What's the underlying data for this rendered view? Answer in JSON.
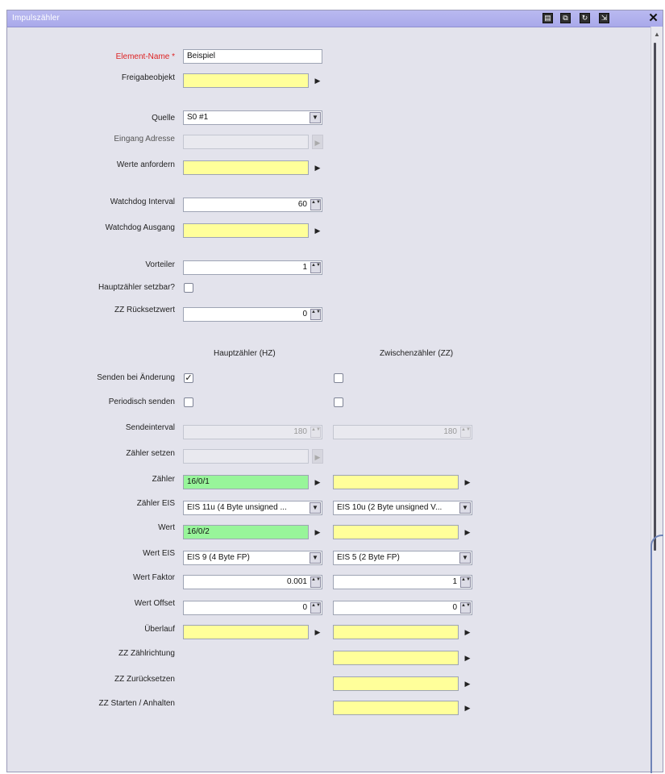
{
  "window": {
    "title": "Impulszähler"
  },
  "titlebar_icons": [
    {
      "name": "document-icon",
      "glyph": "▤"
    },
    {
      "name": "copy-icon",
      "glyph": "⧉"
    },
    {
      "name": "refresh-icon",
      "glyph": "↻"
    },
    {
      "name": "export-icon",
      "glyph": "⇲"
    }
  ],
  "form": {
    "element_name": {
      "label": "Element-Name *",
      "value": "Beispiel"
    },
    "freigabe": {
      "label": "Freigabeobjekt",
      "value": ""
    },
    "quelle": {
      "label": "Quelle",
      "value": "S0 #1"
    },
    "eingang_adresse": {
      "label": "Eingang Adresse",
      "value": ""
    },
    "werte_anfordern": {
      "label": "Werte anfordern",
      "value": ""
    },
    "watchdog_interval": {
      "label": "Watchdog Interval",
      "value": "60"
    },
    "watchdog_ausgang": {
      "label": "Watchdog Ausgang",
      "value": ""
    },
    "vorteiler": {
      "label": "Vorteiler",
      "value": "1"
    },
    "hauptzaehler_setzbar": {
      "label": "Hauptzähler setzbar?",
      "checked": false
    },
    "zz_ruecksetzwert": {
      "label": "ZZ Rücksetzwert",
      "value": "0"
    }
  },
  "columns": {
    "hz": "Hauptzähler (HZ)",
    "zz": "Zwischenzähler (ZZ)"
  },
  "rows": {
    "senden_bei_aenderung": {
      "label": "Senden bei Änderung",
      "hz_checked": true,
      "zz_checked": false
    },
    "periodisch_senden": {
      "label": "Periodisch senden",
      "hz_checked": false,
      "zz_checked": false
    },
    "sendeinterval": {
      "label": "Sendeinterval",
      "hz": "180",
      "zz": "180"
    },
    "zaehler_setzen": {
      "label": "Zähler setzen",
      "hz": ""
    },
    "zaehler": {
      "label": "Zähler",
      "hz": "16/0/1",
      "zz": ""
    },
    "zaehler_eis": {
      "label": "Zähler EIS",
      "hz": "EIS 11u (4 Byte unsigned ...",
      "zz": "EIS 10u (2 Byte unsigned V..."
    },
    "wert": {
      "label": "Wert",
      "hz": "16/0/2",
      "zz": ""
    },
    "wert_eis": {
      "label": "Wert EIS",
      "hz": "EIS 9 (4 Byte FP)",
      "zz": "EIS 5 (2 Byte FP)"
    },
    "wert_faktor": {
      "label": "Wert Faktor",
      "hz": "0.001",
      "zz": "1"
    },
    "wert_offset": {
      "label": "Wert Offset",
      "hz": "0",
      "zz": "0"
    },
    "ueberlauf": {
      "label": "Überlauf",
      "hz": "",
      "zz": ""
    },
    "zz_zaehlrichtung": {
      "label": "ZZ Zählrichtung",
      "zz": ""
    },
    "zz_zuruecksetzen": {
      "label": "ZZ Zurücksetzen",
      "zz": ""
    },
    "zz_starten": {
      "label": "ZZ Starten / Anhalten",
      "zz": ""
    }
  },
  "glyphs": {
    "arrow": "▶",
    "dropdown": "▼",
    "spin": "▲▼",
    "check": "✓",
    "close": "✕",
    "scroll_up": "▲"
  },
  "colors": {
    "title_bar": "#a9a9ea",
    "required_label": "#dd2222",
    "yellow_field": "#ffff9a",
    "green_field": "#98f59a"
  }
}
